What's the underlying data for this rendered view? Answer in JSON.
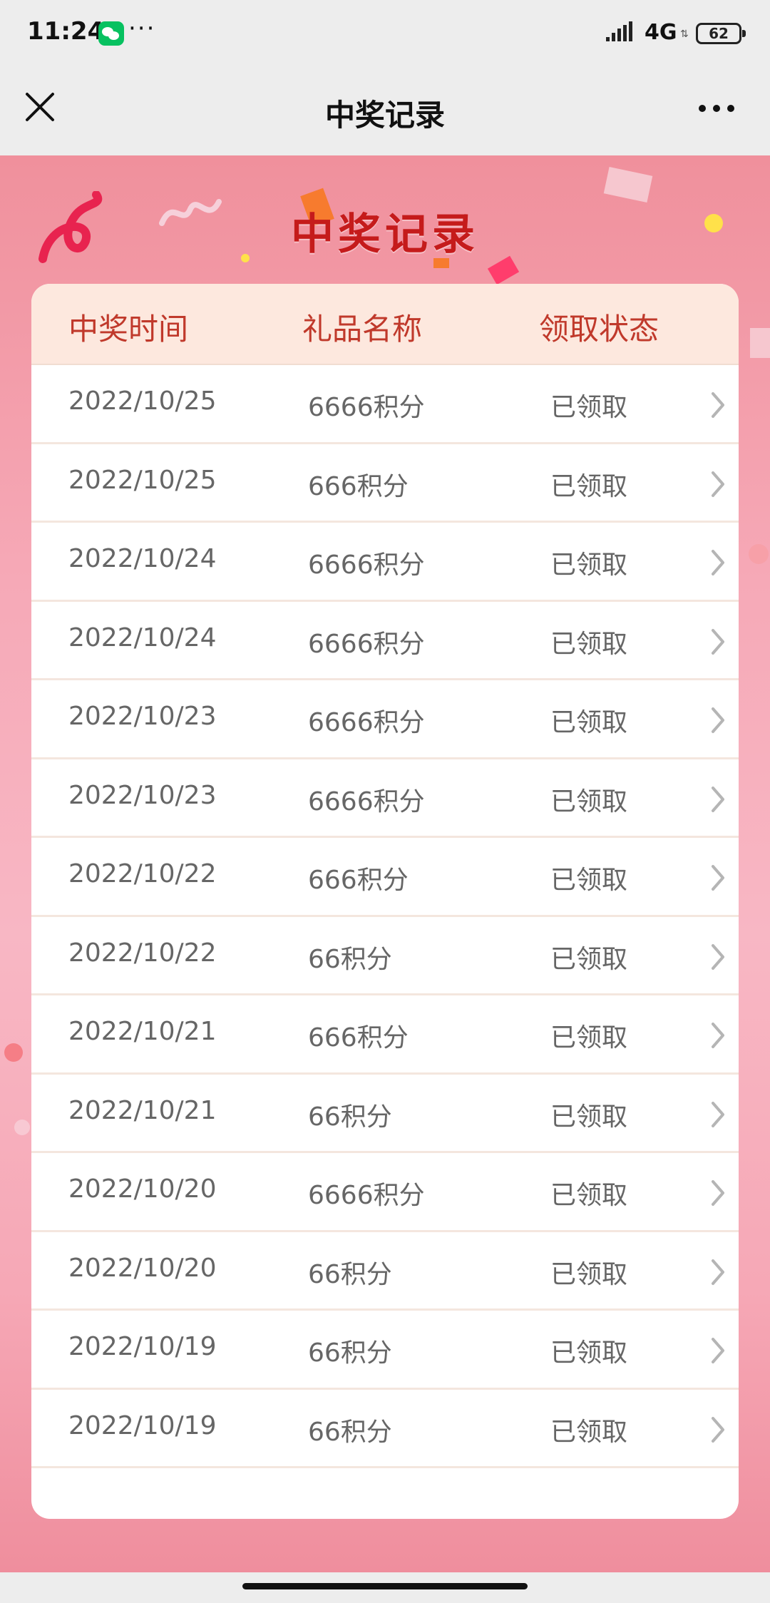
{
  "status_bar": {
    "time": "11:24",
    "dots": "···",
    "network": "4G",
    "battery": "62"
  },
  "nav": {
    "title": "中奖记录",
    "close_icon": "close-icon",
    "more_icon": "more-icon"
  },
  "page": {
    "heading": "中奖记录"
  },
  "table": {
    "headers": [
      "中奖时间",
      "礼品名称",
      "领取状态"
    ],
    "rows": [
      {
        "date": "2022/10/25",
        "gift": "6666积分",
        "status": "已领取"
      },
      {
        "date": "2022/10/25",
        "gift": "666积分",
        "status": "已领取"
      },
      {
        "date": "2022/10/24",
        "gift": "6666积分",
        "status": "已领取"
      },
      {
        "date": "2022/10/24",
        "gift": "6666积分",
        "status": "已领取"
      },
      {
        "date": "2022/10/23",
        "gift": "6666积分",
        "status": "已领取"
      },
      {
        "date": "2022/10/23",
        "gift": "6666积分",
        "status": "已领取"
      },
      {
        "date": "2022/10/22",
        "gift": "666积分",
        "status": "已领取"
      },
      {
        "date": "2022/10/22",
        "gift": "66积分",
        "status": "已领取"
      },
      {
        "date": "2022/10/21",
        "gift": "666积分",
        "status": "已领取"
      },
      {
        "date": "2022/10/21",
        "gift": "66积分",
        "status": "已领取"
      },
      {
        "date": "2022/10/20",
        "gift": "6666积分",
        "status": "已领取"
      },
      {
        "date": "2022/10/20",
        "gift": "66积分",
        "status": "已领取"
      },
      {
        "date": "2022/10/19",
        "gift": "66积分",
        "status": "已领取"
      },
      {
        "date": "2022/10/19",
        "gift": "66积分",
        "status": "已领取"
      }
    ]
  },
  "colors": {
    "accent": "#c51b1b",
    "header_bg": "#fde8de",
    "page_bg": "#f6a9b7"
  }
}
